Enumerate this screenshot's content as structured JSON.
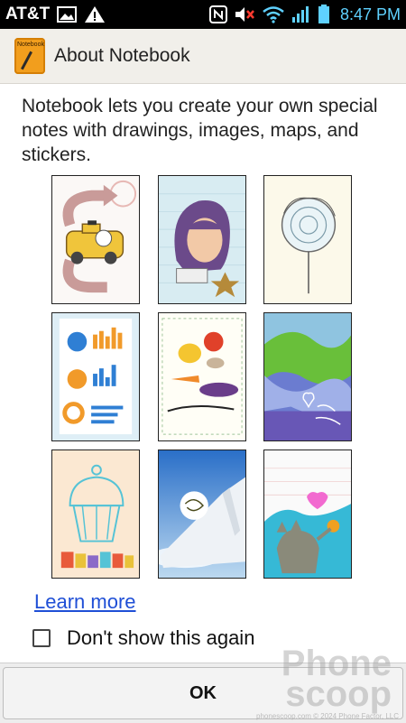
{
  "status_bar": {
    "carrier": "AT&T",
    "time": "8:47 PM",
    "left_icons": [
      "gallery-icon",
      "warning-icon"
    ],
    "right_icons": [
      "nfc-icon",
      "muted-icon",
      "wifi-icon",
      "signal-icon",
      "battery-icon"
    ],
    "clock_color": "#5fd1ff"
  },
  "titlebar": {
    "title": "About Notebook",
    "app_icon_label": "Notebook"
  },
  "description": "Notebook lets you create your own special notes with drawings, images, maps, and stickers.",
  "thumbnails": [
    {
      "name": "taxi-cat-sketch"
    },
    {
      "name": "portrait-sheriff"
    },
    {
      "name": "flower-drawing"
    },
    {
      "name": "infographic-charts"
    },
    {
      "name": "recipe-vegetables"
    },
    {
      "name": "love-mom-painting"
    },
    {
      "name": "birthday-cupcake"
    },
    {
      "name": "airplane-wing"
    },
    {
      "name": "cat-sky-drawing"
    }
  ],
  "learn_more": "Learn more",
  "dont_show_again": {
    "label": "Don't show this again",
    "checked": false
  },
  "ok_button": "OK",
  "watermark": {
    "line1": "Phone",
    "line2": "scoop",
    "footer": "phonescoop.com  © 2024 Phone Factor, LLC"
  },
  "colors": {
    "link": "#1f4fd6",
    "titlebar_bg": "#f1efea",
    "app_icon": "#f29e1d"
  }
}
